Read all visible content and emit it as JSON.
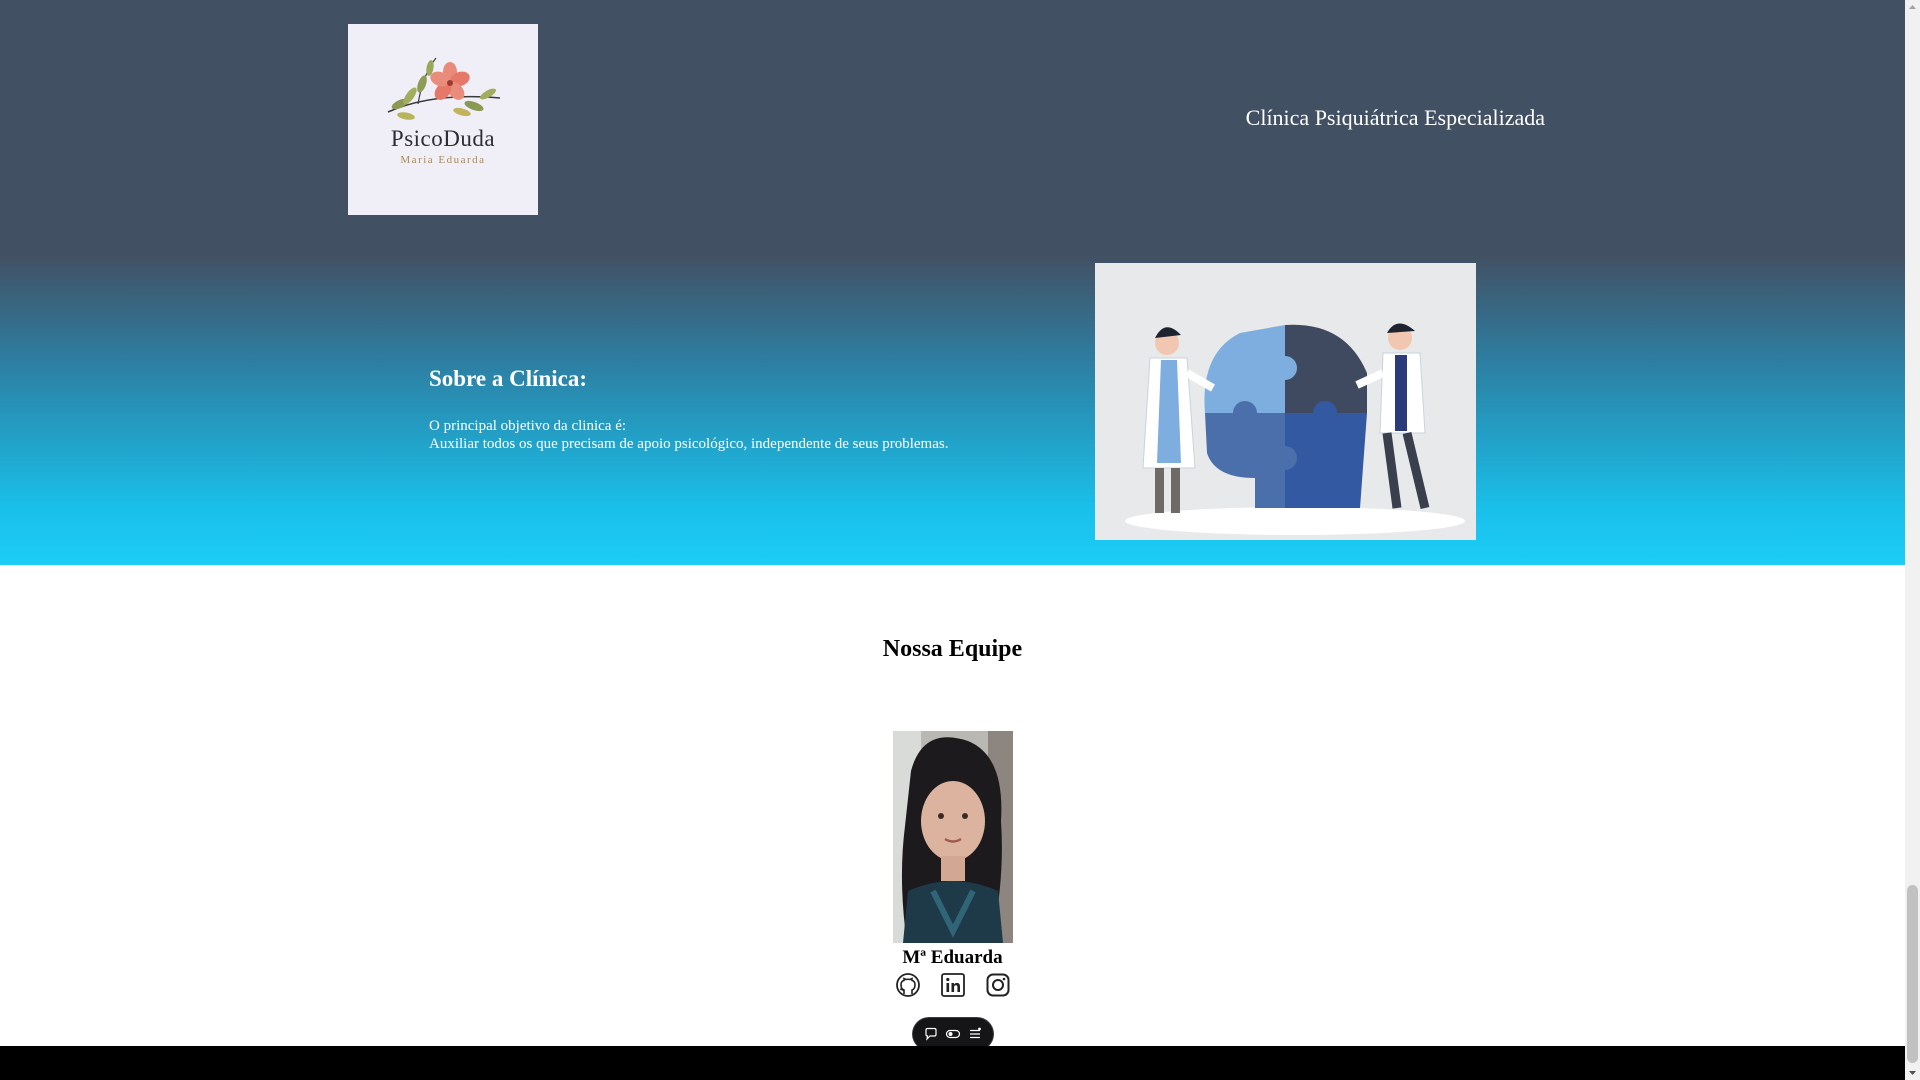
{
  "header": {
    "logo": {
      "name": "PsicoDuda",
      "subtitle": "Maria Eduarda"
    },
    "title": "Clínica Psiquiátrica Especializada"
  },
  "about": {
    "heading": "Sobre a Clínica:",
    "line1": "O principal objetivo da clinica é:",
    "line2": "Auxiliar todos os que precisam de apoio psicológico, independente de seus problemas.",
    "image_icon": "puzzle-head-illustration"
  },
  "team": {
    "heading": "Nossa Equipe",
    "members": [
      {
        "name": "Mª Eduarda",
        "photo_icon": "member-photo",
        "socials": [
          "github-icon",
          "linkedin-icon",
          "instagram-icon"
        ]
      }
    ]
  },
  "toolbar": {
    "buttons": [
      "comment-icon",
      "toggle-icon",
      "menu-icon"
    ]
  },
  "colors": {
    "header_bg": "#425063",
    "hero_bottom": "#1ccdf6",
    "footer_bg": "#000000"
  }
}
